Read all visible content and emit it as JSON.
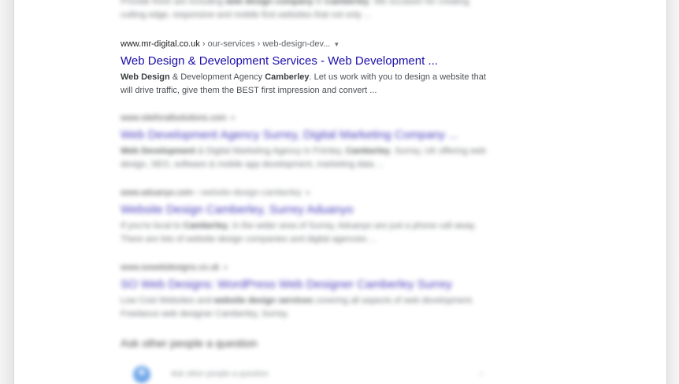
{
  "results": [
    {
      "id": "r0",
      "cite_domain": "",
      "cite_path": "",
      "title": "",
      "snippet_pre": "Provide fresh are including",
      "snippet_bold1": "web design company",
      "snippet_mid": "in",
      "snippet_bold2": "Camberley",
      "snippet_post": ". We occasion for creating cutting edge, responsive and mobile first websites that not only ..."
    },
    {
      "id": "r1",
      "cite_domain": "www.mr-digital.co.uk",
      "cite_path": " › our-services › web-design-dev...",
      "title": "Web Design & Development Services - Web Development ...",
      "snippet_bold1": "Web Design",
      "snippet_mid": " & Development Agency ",
      "snippet_bold2": "Camberley",
      "snippet_post": ". Let us work with you to design a website that will drive traffic, give them the BEST first impression and convert ..."
    },
    {
      "id": "r2",
      "cite_domain": "www.siteforallsolutions.com",
      "cite_path": "",
      "title": "Web Development Agency Surrey, Digital Marketing Company ...",
      "snippet_bold1": "Web Development",
      "snippet_mid": " & Digital Marketing Agency in Frimley, ",
      "snippet_bold2": "Camberley",
      "snippet_post": ", Surrey, UK offering web design, SEO, software & mobile app development, marketing data ..."
    },
    {
      "id": "r3",
      "cite_domain": "www.aduanyo.com",
      "cite_path": " › website-design-camberley",
      "title": "Website Design Camberley, Surrey Aduanyo",
      "snippet_bold1": "",
      "snippet_mid": "If you're local to ",
      "snippet_bold2": "Camberley",
      "snippet_post": ", in the wider area of Surrey, Aduanyo are just a phone call away. There are lots of website design companies and digital agencies ..."
    },
    {
      "id": "r4",
      "cite_domain": "www.sowebdesigns.co.uk",
      "cite_path": "",
      "title": "SO Web Designs: WordPress Web Designer Camberley Surrey",
      "snippet_bold1": "",
      "snippet_mid": "Low Cost Websites and ",
      "snippet_bold2": "website design services",
      "snippet_post": " covering all aspects of web development. Freelance web designer Camberley, Surrey."
    }
  ],
  "paa": {
    "heading": "Ask other people a question",
    "placeholder": "Ask other people a question"
  },
  "colors": {
    "link": "#1a0dab",
    "text": "#4d5156",
    "cite": "#202124"
  }
}
